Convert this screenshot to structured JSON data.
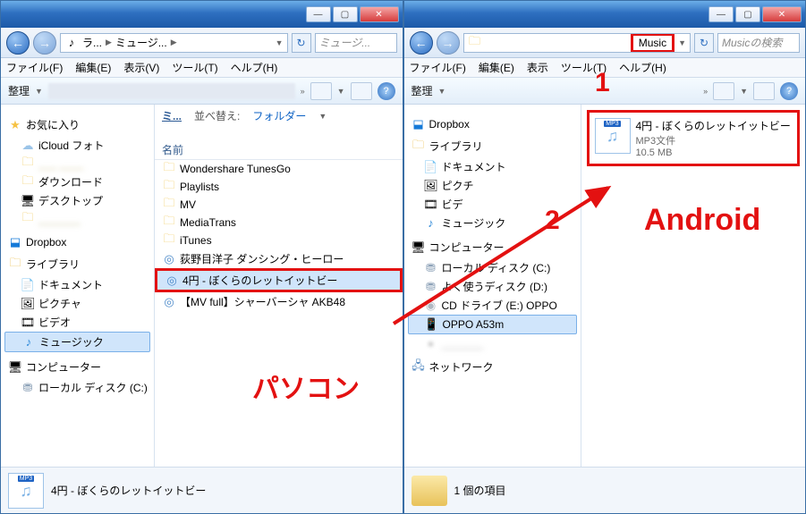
{
  "left": {
    "addr_crumbs": [
      "ラ...",
      "ミュージ..."
    ],
    "search_placeholder": "ミュージ...",
    "menu": [
      "ファイル(F)",
      "編集(E)",
      "表示(V)",
      "ツール(T)",
      "ヘルプ(H)"
    ],
    "toolbar_organize": "整理",
    "tree": {
      "fav": "お気に入り",
      "nodes": [
        "iCloud フォト",
        "ダウンロード",
        "デスクトップ"
      ],
      "dropbox": "Dropbox",
      "lib": "ライブラリ",
      "libs": [
        "ドキュメント",
        "ピクチャ",
        "ビデオ",
        "ミュージック"
      ],
      "comp": "コンピューター",
      "drives": [
        "ローカル ディスク (C:)"
      ]
    },
    "content": {
      "mi": "ミ...",
      "sort_label": "並べ替え:",
      "sort_value": "フォルダー",
      "name_header": "名前",
      "rows": [
        "Wondershare TunesGo",
        "Playlists",
        "MV",
        "MediaTrans",
        "iTunes",
        "荻野目洋子  ダンシング・ヒーロー",
        "4円 - ぼくらのレットイットビー",
        "【MV full】シャーバーシャ  AKB48"
      ]
    },
    "status_file": "4円 - ぼくらのレットイットビー"
  },
  "right": {
    "addr_label": "Music",
    "search_placeholder": "Musicの検索",
    "menu": [
      "ファイル(F)",
      "編集(E)",
      "表示",
      "ツール(T)",
      "ヘルプ(H)"
    ],
    "toolbar_organize": "整理",
    "tree": {
      "dropbox": "Dropbox",
      "lib": "ライブラリ",
      "libs": [
        "ドキュメント",
        "ピクチ",
        "ビデ",
        "ミュージック"
      ],
      "comp": "コンピューター",
      "drives": [
        "ローカル ディスク (C:)",
        "よく使うディスク (D:)",
        "CD ドライブ (E:) OPPO",
        "OPPO A53m"
      ],
      "net": "ネットワーク"
    },
    "file": {
      "name": "4円 - ぼくらのレットイットビー",
      "type": "MP3文件",
      "size": "10.5 MB"
    },
    "status": "1 個の項目"
  },
  "annotations": {
    "one": "1",
    "two": "2",
    "pc": "パソコン",
    "android": "Android"
  },
  "mp3_tag": "MP3"
}
